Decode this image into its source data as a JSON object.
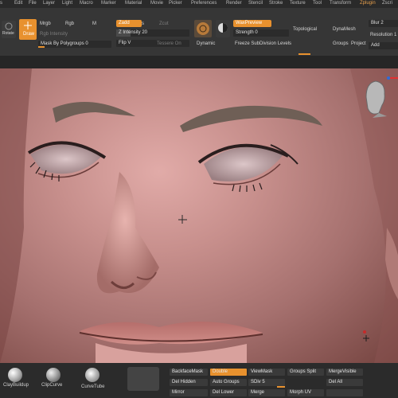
{
  "menu": [
    "s",
    "Edit",
    "File",
    "Layer",
    "Light",
    "Macro",
    "Marker",
    "Material",
    "Movie",
    "Picker",
    "Preferences",
    "Render",
    "Stencil",
    "Stroke",
    "Texture",
    "Tool",
    "Transform",
    "Zplugin",
    "Zscri"
  ],
  "shelf": {
    "rotate_label": "Rotate",
    "draw_label": "Draw",
    "mrgb_label": "Mrgb",
    "rgb_label": "Rgb",
    "m_label": "M",
    "rgb_intensity_label": "Rgb Intensity",
    "mask_by_polygroups_label": "Mask By Polygroups 0",
    "zadd_label": "Zadd",
    "zsub_label": "s",
    "zcut_label": "Zcut",
    "z_intensity_label": "Z Intensity 20",
    "z_intensity_value": 0.2,
    "flip_v_label": "Flip V",
    "focal_shift_label": "Tessere On",
    "dynamic_label": "Dynamic",
    "material_label": "WaxPreview",
    "strength_label": "Strength 0",
    "freeze_subdiv_label": "Freeze SubDivision Levels",
    "topological_label": "Topological",
    "dynamesh_label": "DynaMesh",
    "groups_label": "Groups",
    "project_label": "Project",
    "blur_label": "Blur 2",
    "resolution_label": "Resolution 1",
    "add_label": "Add"
  },
  "bottom": {
    "brushes": [
      "ClayBuildup",
      "ClipCurve",
      "CurveTube"
    ],
    "buttons_row1": [
      "BackfaceMask",
      "Double",
      "ViewMask",
      "Groups Split",
      "MergeVisible"
    ],
    "buttons_row2": [
      "Del Hidden",
      "Auto Groups",
      "SDiv 5",
      "",
      "Del All"
    ],
    "buttons_row3": [
      "Mirror",
      "Del Lower",
      "Merge",
      "Morph UV",
      ""
    ]
  },
  "colors": {
    "accent": "#e8912e",
    "panel": "#363636",
    "skin": "#c78f8c"
  },
  "icons": [
    "rotate-icon",
    "draw-icon",
    "material-sphere-icon",
    "dynamic-icon",
    "head-navigation-icon",
    "crosshair-icon"
  ]
}
